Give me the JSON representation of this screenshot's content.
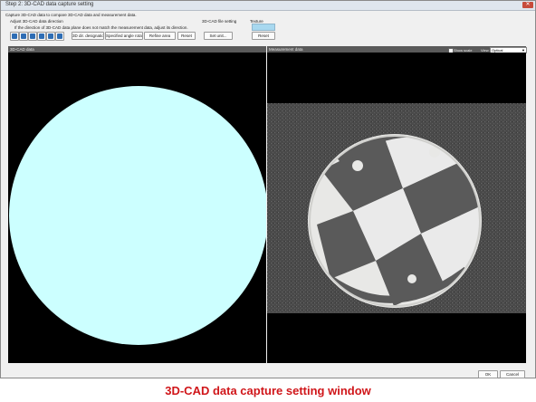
{
  "window": {
    "title": "Step 2: 3D-CAD data capture setting"
  },
  "header": {
    "instruction": "Capture 3D-CAD data to compare 3D-CAD data and measurement data.",
    "adjust_label": "Adjust 3D-CAD data direction",
    "adjust_hint": "If the direction of 3D-CAD data plane does not match the measurement data, adjust its direction.",
    "file_setting_label": "3D-CAD file setting",
    "texture_label": "Texture"
  },
  "toolbar": {
    "dir_designation": "3D dir. designation",
    "specified_angle": "Specified angle rotation",
    "refine_area": "Refine area",
    "reset": "Reset",
    "set_unit": "Set unit...",
    "texture_reset": "Reset"
  },
  "panels": {
    "cad_title": "3D-CAD data",
    "measurement_title": "Measurement data",
    "show_scale_label": "Show scale",
    "view_label": "View",
    "view_value": "Optical"
  },
  "footer": {
    "ok": "OK",
    "cancel": "Cancel"
  },
  "caption": "3D-CAD data capture setting window",
  "colors": {
    "cad_fill": "#ccffff",
    "caption": "#d0161a",
    "icon_accent": "#2e6db4",
    "texture": "#a8d8ef"
  },
  "icons": [
    "rotate-left-icon",
    "rotate-right-icon",
    "flip-horizontal-icon",
    "flip-vertical-icon",
    "rotate-ccw-icon",
    "rotate-cw-icon"
  ]
}
